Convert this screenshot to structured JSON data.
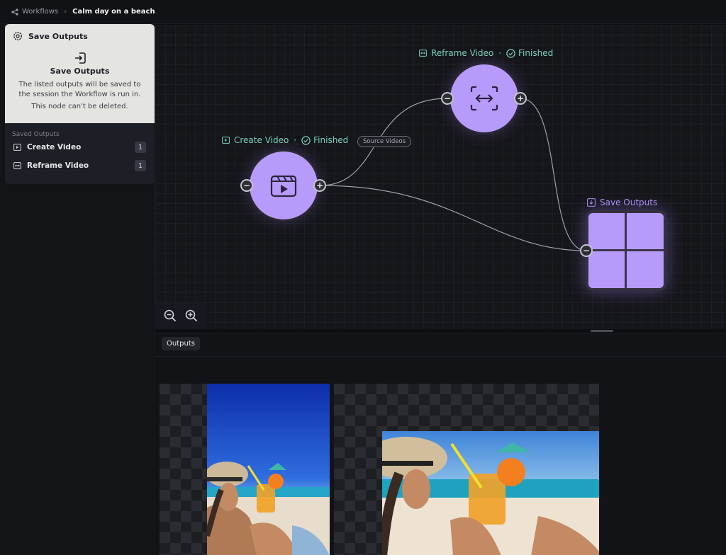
{
  "breadcrumb": {
    "root": "Workflows",
    "current": "Calm day on a beach"
  },
  "node_panel": {
    "header": "Save Outputs",
    "title": "Save Outputs",
    "description": "The listed outputs will be saved to the session the Workflow is run in.",
    "note": "This node can't be deleted."
  },
  "saved_outputs": {
    "label": "Saved Outputs",
    "items": [
      {
        "name": "Create Video",
        "count": "1"
      },
      {
        "name": "Reframe Video",
        "count": "1"
      }
    ]
  },
  "canvas": {
    "create_video": {
      "name": "Create Video",
      "dot": "·",
      "status": "Finished"
    },
    "reframe_video": {
      "name": "Reframe Video",
      "dot": "·",
      "status": "Finished"
    },
    "save_outputs": {
      "name": "Save Outputs"
    },
    "edge_tag": "Source Videos",
    "port_minus": "−",
    "port_plus": "+"
  },
  "outputs": {
    "tab": "Outputs"
  },
  "colors": {
    "accent": "#b79bfa",
    "status": "#79d1b9",
    "save_label": "#ad8ef5"
  }
}
